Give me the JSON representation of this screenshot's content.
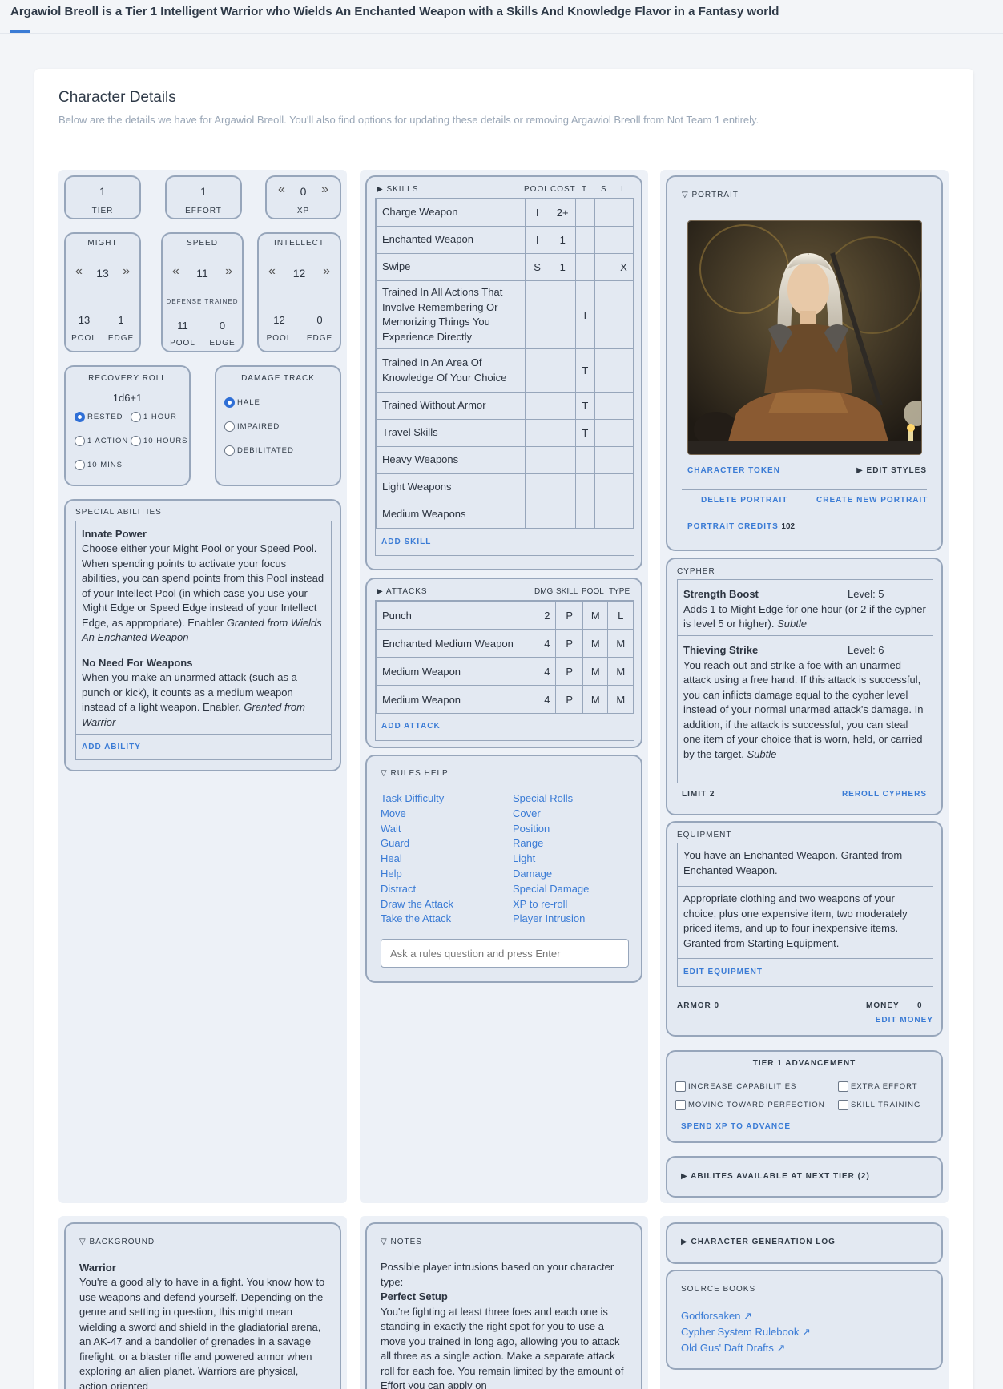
{
  "header": {
    "title": "Argawiol Breoll is a Tier 1 Intelligent Warrior who Wields An Enchanted Weapon with a Skills And Knowledge Flavor in a Fantasy world"
  },
  "details": {
    "title": "Character Details",
    "desc": "Below are the details we have for Argawiol Breoll. You'll also find options for updating these details or removing Argawiol Breoll from Not Team 1 entirely."
  },
  "stats": {
    "tier": "1",
    "tier_label": "TIER",
    "effort": "1",
    "effort_label": "EFFORT",
    "xp": "0",
    "xp_label": "XP",
    "might": {
      "label": "MIGHT",
      "value": "13",
      "pool": "13",
      "edge": "1"
    },
    "speed": {
      "label": "SPEED",
      "value": "11",
      "note": "DEFENSE TRAINED",
      "pool": "11",
      "edge": "0"
    },
    "intellect": {
      "label": "INTELLECT",
      "value": "12",
      "pool": "12",
      "edge": "0"
    },
    "pool_label": "POOL",
    "edge_label": "EDGE"
  },
  "recovery": {
    "label": "RECOVERY ROLL",
    "roll": "1d6+1",
    "options": [
      "RESTED",
      "1 HOUR",
      "1 ACTION",
      "10 HOURS",
      "10 MINS"
    ]
  },
  "damage": {
    "label": "DAMAGE TRACK",
    "options": [
      "HALE",
      "IMPAIRED",
      "DEBILITATED"
    ]
  },
  "abilities": {
    "label": "SPECIAL ABILITIES",
    "items": [
      {
        "name": "Innate Power",
        "text": "Choose either your Might Pool or your Speed Pool. When spending points to activate your focus abilities, you can spend points from this Pool instead of your Intellect Pool (in which case you use your Might Edge or Speed Edge instead of your Intellect Edge, as appropriate). Enabler",
        "granted": "Granted from Wields An Enchanted Weapon"
      },
      {
        "name": "No Need For Weapons",
        "text": "When you make an unarmed attack (such as a punch or kick), it counts as a medium weapon instead of a light weapon. Enabler.",
        "granted": "Granted from Warrior"
      }
    ],
    "add": "ADD ABILITY"
  },
  "skills": {
    "label": "SKILLS",
    "headers": [
      "POOL",
      "COST",
      "T",
      "S",
      "I"
    ],
    "rows": [
      [
        "Charge Weapon",
        "I",
        "2+",
        "",
        "",
        ""
      ],
      [
        "Enchanted Weapon",
        "I",
        "1",
        "",
        "",
        ""
      ],
      [
        "Swipe",
        "S",
        "1",
        "",
        "",
        "X"
      ],
      [
        "Trained In All Actions That Involve Remembering Or Memorizing Things You Experience Directly",
        "",
        "",
        "T",
        "",
        ""
      ],
      [
        "Trained In An Area Of Knowledge Of Your Choice",
        "",
        "",
        "T",
        "",
        ""
      ],
      [
        "Trained Without Armor",
        "",
        "",
        "T",
        "",
        ""
      ],
      [
        "Travel Skills",
        "",
        "",
        "T",
        "",
        ""
      ],
      [
        "Heavy Weapons",
        "",
        "",
        "",
        "",
        ""
      ],
      [
        "Light Weapons",
        "",
        "",
        "",
        "",
        ""
      ],
      [
        "Medium Weapons",
        "",
        "",
        "",
        "",
        ""
      ]
    ],
    "add": "ADD SKILL"
  },
  "attacks": {
    "label": "ATTACKS",
    "headers": [
      "DMG",
      "SKILL",
      "POOL",
      "TYPE"
    ],
    "rows": [
      [
        "Punch",
        "2",
        "P",
        "M",
        "L"
      ],
      [
        "Enchanted Medium Weapon",
        "4",
        "P",
        "M",
        "M"
      ],
      [
        "Medium Weapon",
        "4",
        "P",
        "M",
        "M"
      ],
      [
        "Medium Weapon",
        "4",
        "P",
        "M",
        "M"
      ]
    ],
    "add": "ADD ATTACK"
  },
  "rules": {
    "label": "RULES HELP",
    "left": [
      "Task Difficulty",
      "Move",
      "Wait",
      "Guard",
      "Heal",
      "Help",
      "Distract",
      "Draw the Attack",
      "Take the Attack"
    ],
    "right": [
      "Special Rolls",
      "Cover",
      "Position",
      "Range",
      "Light",
      "Damage",
      "Special Damage",
      "XP to re-roll",
      "Player Intrusion"
    ],
    "placeholder": "Ask a rules question and press Enter"
  },
  "portrait": {
    "label": "PORTRAIT",
    "token": "CHARACTER TOKEN",
    "styles": "EDIT STYLES",
    "delete": "DELETE PORTRAIT",
    "create": "CREATE NEW PORTRAIT",
    "credits_label": "PORTRAIT CREDITS",
    "credits": "102"
  },
  "cypher": {
    "label": "CYPHER",
    "items": [
      {
        "name": "Strength Boost",
        "level": "Level: 5",
        "text": "Adds 1 to Might Edge for one hour (or 2 if the cypher is level 5 or higher).",
        "tag": "Subtle"
      },
      {
        "name": "Thieving Strike",
        "level": "Level: 6",
        "text": "You reach out and strike a foe with an unarmed attack using a free hand. If this attack is successful, you can inflicts damage equal to the cypher level instead of your normal unarmed attack's damage. In addition, if the attack is successful, you can steal one item of your choice that is worn, held, or carried by the target.",
        "tag": "Subtle"
      }
    ],
    "limit": "LIMIT 2",
    "reroll": "REROLL CYPHERS"
  },
  "equipment": {
    "label": "EQUIPMENT",
    "items": [
      "You have an Enchanted Weapon. Granted from Enchanted Weapon.",
      "Appropriate clothing and two weapons of your choice, plus one expensive item, two moderately priced items, and up to four inexpensive items. Granted from Starting Equipment."
    ],
    "edit": "EDIT EQUIPMENT",
    "armor": "ARMOR 0",
    "money_label": "MONEY",
    "money": "0",
    "edit_money": "EDIT MONEY"
  },
  "advancement": {
    "label": "TIER 1 ADVANCEMENT",
    "items": [
      "INCREASE CAPABILITIES",
      "EXTRA EFFORT",
      "MOVING TOWARD PERFECTION",
      "SKILL TRAINING"
    ],
    "spend": "SPEND XP TO ADVANCE"
  },
  "next_tier": {
    "label": "ABILITES AVAILABLE AT NEXT TIER (2)"
  },
  "background": {
    "label": "BACKGROUND",
    "name": "Warrior",
    "text": "You're a good ally to have in a fight. You know how to use weapons and defend yourself. Depending on the genre and setting in question, this might mean wielding a sword and shield in the gladiatorial arena, an AK-47 and a bandolier of grenades in a savage firefight, or a blaster rifle and powered armor when exploring an alien planet. Warriors are physical, action-oriented"
  },
  "notes": {
    "label": "NOTES",
    "intro": "Possible player intrusions based on your character type:",
    "name": "Perfect Setup",
    "text": "You're fighting at least three foes and each one is standing in exactly the right spot for you to use a move you trained in long ago, allowing you to attack all three as a single action. Make a separate attack roll for each foe. You remain limited by the amount of Effort you can apply on"
  },
  "genlog": {
    "label": "CHARACTER GENERATION LOG"
  },
  "sources": {
    "label": "SOURCE BOOKS",
    "items": [
      "Godforsaken",
      "Cypher System Rulebook",
      "Old Gus' Daft Drafts"
    ]
  },
  "colors": {
    "accent": "#3a7bd5",
    "border": "#97a6bb",
    "panel": "#e3e9f2"
  }
}
